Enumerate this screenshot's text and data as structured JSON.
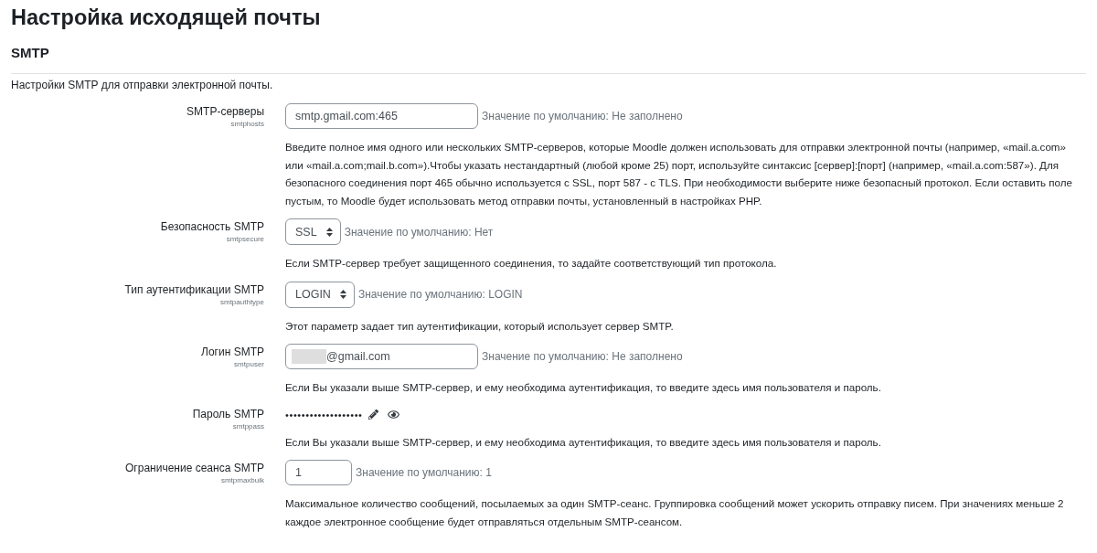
{
  "page": {
    "title": "Настройка исходящей почты"
  },
  "section": {
    "heading": "SMTP",
    "intro": "Настройки SMTP для отправки электронной почты."
  },
  "settings": [
    {
      "kind": "text",
      "label": "SMTP-серверы",
      "key": "smtphosts",
      "value": "smtp.gmail.com:465",
      "redacted": false,
      "default": "Значение по умолчанию: Не заполнено",
      "description": "Введите полное имя одного или нескольких SMTP-серверов, которые Moodle должен использовать для отправки электронной почты (например, «mail.a.com» или «mail.a.com;mail.b.com»).Чтобы указать нестандартный (любой кроме 25) порт, используйте синтаксис [сервер]:[порт] (например, «mail.a.com:587»). Для безопасного соединения порт 465 обычно используется с SSL, порт 587 - с TLS. При необходимости выберите ниже безопасный протокол. Если оставить поле пустым, то Moodle будет использовать метод отправки почты, установленный в настройках PHP."
    },
    {
      "kind": "select",
      "label": "Безопасность SMTP",
      "key": "smtpsecure",
      "value": "SSL",
      "default": "Значение по умолчанию: Нет",
      "description": "Если SMTP-сервер требует защищенного соединения, то задайте соответствующий тип протокола."
    },
    {
      "kind": "select",
      "label": "Тип аутентификации SMTP",
      "key": "smtpauthtype",
      "value": "LOGIN",
      "default": "Значение по умолчанию: LOGIN",
      "description": "Этот параметр задает тип аутентификации, который использует сервер SMTP."
    },
    {
      "kind": "text",
      "label": "Логин SMTP",
      "key": "smtpuser",
      "value": "@gmail.com",
      "redacted": true,
      "default": "Значение по умолчанию: Не заполнено",
      "description": "Если Вы указали выше SMTP-сервер, и ему необходима аутентификация, то введите здесь имя пользователя и пароль."
    },
    {
      "kind": "password",
      "label": "Пароль SMTP",
      "key": "smtppass",
      "value": "•••••••••••••••••••",
      "description": "Если Вы указали выше SMTP-сервер, и ему необходима аутентификация, то введите здесь имя пользователя и пароль."
    },
    {
      "kind": "number",
      "label": "Ограничение сеанса SMTP",
      "key": "smtpmaxbulk",
      "value": "1",
      "default": "Значение по умолчанию: 1",
      "description": "Максимальное количество сообщений, посылаемых за один SMTP-сеанс. Группировка сообщений может ускорить отправку писем. При значениях меньше 2 каждое электронное сообщение будет отправляться отдельным SMTP-сеансом."
    }
  ]
}
